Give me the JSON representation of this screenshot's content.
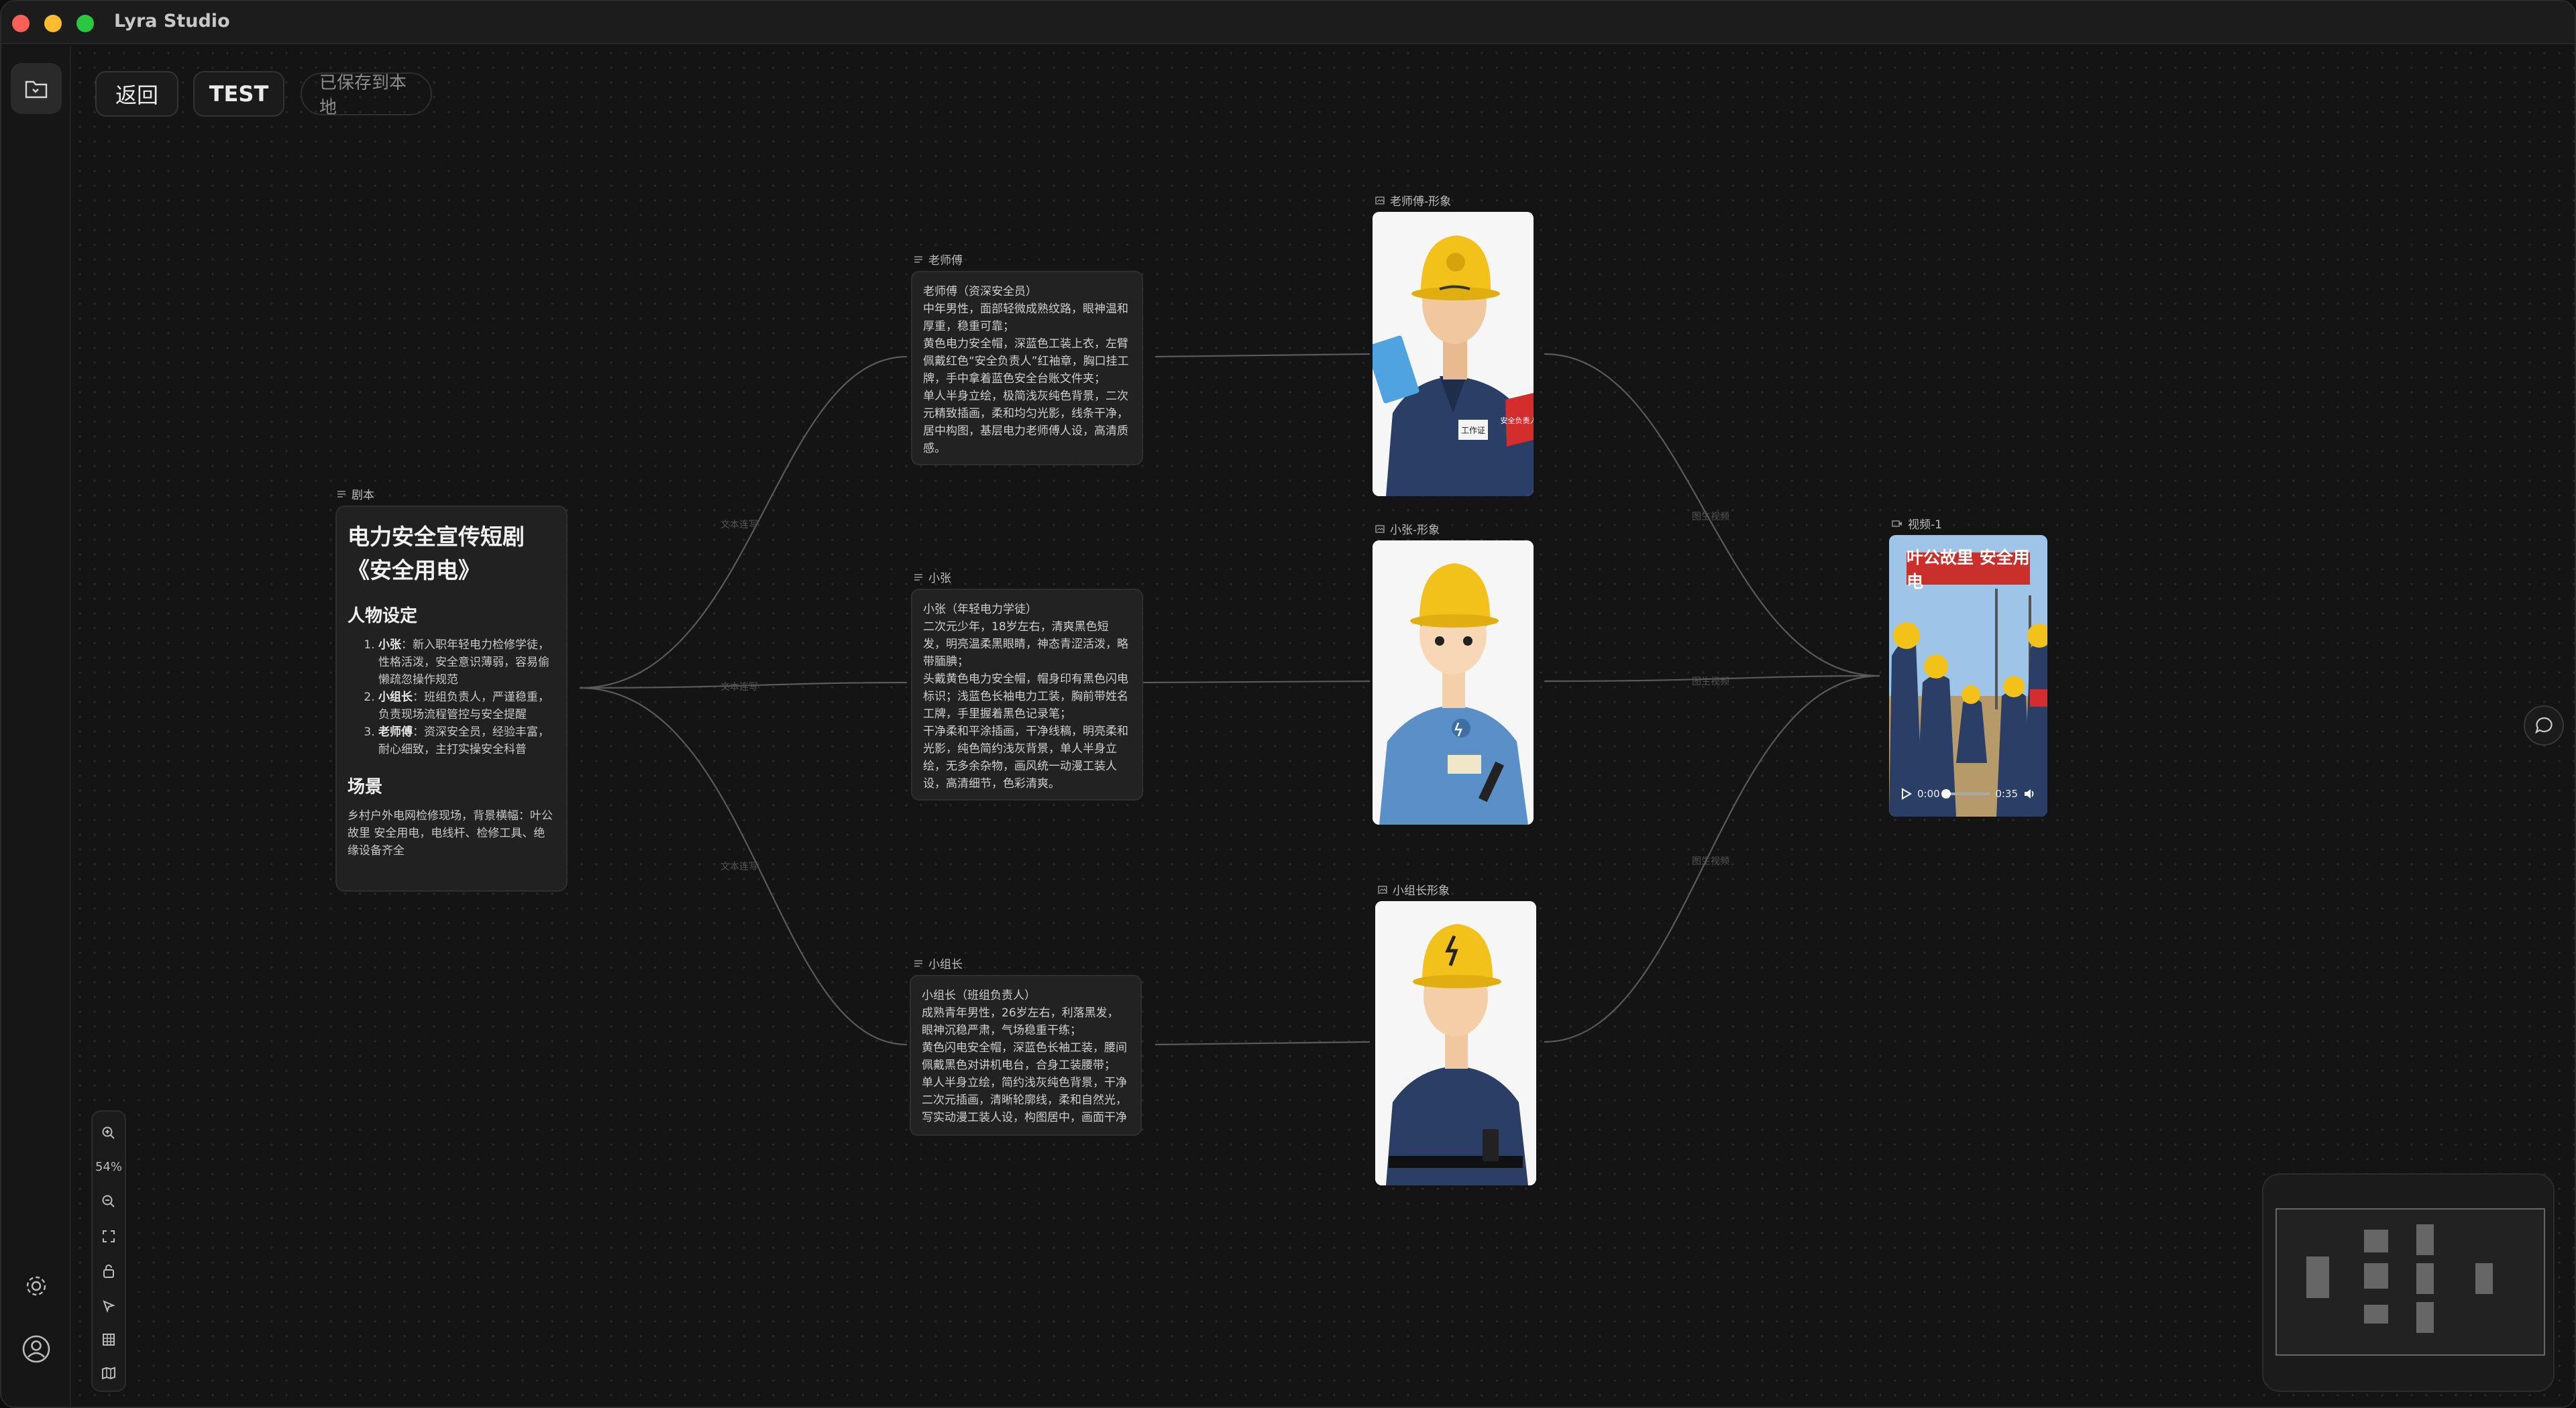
{
  "app": {
    "title": "Lyra Studio"
  },
  "toolbar": {
    "back_label": "返回",
    "project_label": "TEST",
    "saved_status": "已保存到本地"
  },
  "zoom": {
    "level": "54%"
  },
  "nodes": {
    "script": {
      "label": "剧本",
      "title_line1": "电力安全宣传短剧",
      "title_line2": "《安全用电》",
      "section_characters": "人物设定",
      "characters": [
        {
          "name": "小张",
          "desc": "新入职年轻电力检修学徒，性格活泼，安全意识薄弱，容易偷懒疏忽操作规范"
        },
        {
          "name": "小组长",
          "desc": "班组负责人，严谨稳重，负责现场流程管控与安全提醒"
        },
        {
          "name": "老师傅",
          "desc": "资深安全员，经验丰富，耐心细致，主打实操安全科普"
        }
      ],
      "section_scene": "场景",
      "scene_text": "乡村户外电网检修现场，背景横幅：叶公故里 安全用电，电线杆、检修工具、绝缘设备齐全"
    },
    "laoshifu_text": {
      "label": "老师傅",
      "text": "老师傅（资深安全员）\n中年男性，面部轻微成熟纹路，眼神温和厚重，稳重可靠；\n黄色电力安全帽，深蓝色工装上衣，左臂佩戴红色“安全负责人”红袖章，胸口挂工牌，手中拿着蓝色安全台账文件夹；\n单人半身立绘，极简浅灰纯色背景，二次元精致插画，柔和均匀光影，线条干净，居中构图，基层电力老师傅人设，高清质感。"
    },
    "xiaozhang_text": {
      "label": "小张",
      "text": "小张（年轻电力学徒）\n二次元少年，18岁左右，清爽黑色短发，明亮温柔黑眼睛，神态青涩活泼，略带腼腆；\n头戴黄色电力安全帽，帽身印有黑色闪电标识；浅蓝色长袖电力工装，胸前带姓名工牌，手里握着黑色记录笔；\n干净柔和平涂插画，干净线稿，明亮柔和光影，纯色简约浅灰背景，单人半身立绘，无多余杂物，画风统一动漫工装人设，高清细节，色彩清爽。"
    },
    "xiaozuzhang_text": {
      "label": "小组长",
      "text": "小组长（班组负责人）\n成熟青年男性，26岁左右，利落黑发，眼神沉稳严肃，气场稳重干练；\n黄色闪电安全帽，深蓝色长袖工装，腰间佩戴黑色对讲机电台，合身工装腰带；\n单人半身立绘，简约浅灰纯色背景，干净二次元插画，清晰轮廓线，柔和自然光，写实动漫工装人设，构图居中，画面干净"
    },
    "laoshifu_image": {
      "label": "老师傅-形象",
      "badge": "工作证",
      "armband": "安全负责人"
    },
    "xiaozhang_image": {
      "label": "小张-形象"
    },
    "xiaozuzhang_image": {
      "label": "小组长形象"
    },
    "video": {
      "label": "视频-1",
      "banner": "叶公故里 安全用电",
      "time_current": "0:00",
      "time_total": "0:35"
    }
  },
  "edges": {
    "text_to_text": "文本连写",
    "image_to_video": "图生视频"
  },
  "colors": {
    "canvas": "#141414",
    "node_bg": "#222222",
    "helmet": "#f2c21b",
    "uniform": "#2b3f66",
    "armband": "#d42d2d",
    "banner": "#c9302c"
  },
  "icons": [
    "folder-icon",
    "settings-icon",
    "user-icon",
    "zoom-in-icon",
    "zoom-out-icon",
    "fit-view-icon",
    "lock-icon",
    "pointer-icon",
    "grid-icon",
    "map-icon",
    "chat-icon",
    "play-icon",
    "volume-icon",
    "text-node-icon",
    "image-node-icon",
    "video-node-icon"
  ]
}
